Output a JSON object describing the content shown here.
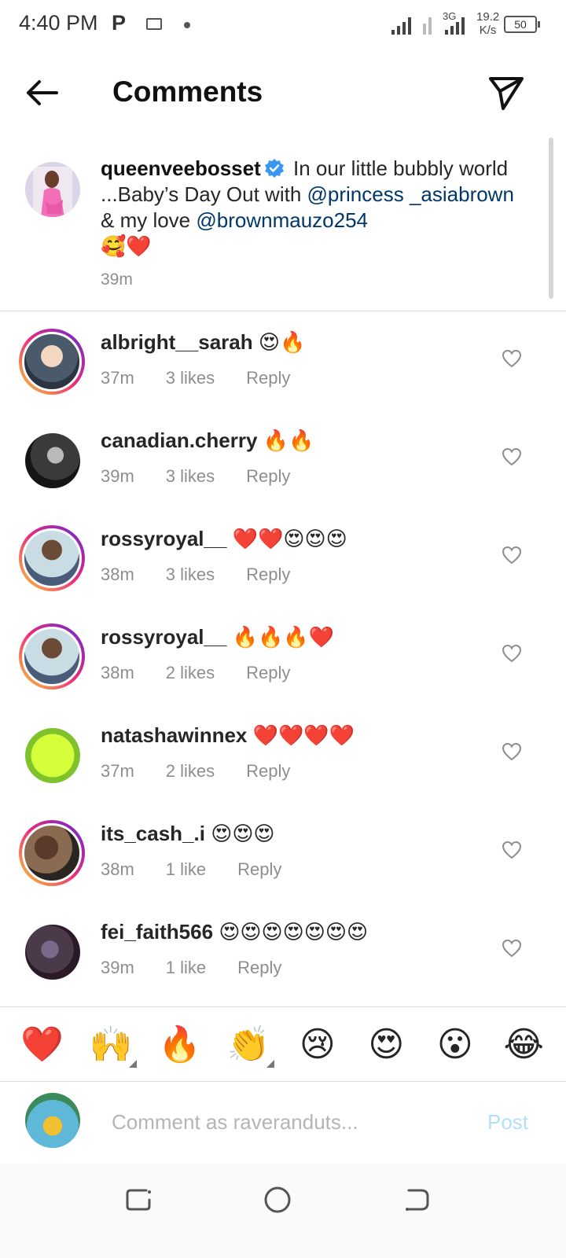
{
  "status_bar": {
    "time": "4:40 PM",
    "p_label": "P",
    "network_type": "3G",
    "speed_value": "19.2",
    "speed_unit": "K/s",
    "battery": "50"
  },
  "header": {
    "title": "Comments",
    "back_icon": "back-arrow-icon",
    "send_icon": "paper-plane-icon"
  },
  "caption": {
    "username": "queenveebosset",
    "verified": true,
    "text_1": " In our little bubbly world ...Baby’s Day Out with ",
    "mention_1": "@princess _asiabrown",
    "text_2": " & my love ",
    "mention_2": "@brownmauzo254",
    "emoji": "🥰❤️",
    "time": "39m"
  },
  "comments": [
    {
      "username": "albright__sarah",
      "text": "😍🔥",
      "time": "37m",
      "likes": "3 likes",
      "reply": "Reply",
      "story_ring": true
    },
    {
      "username": "canadian.cherry",
      "text": "🔥🔥",
      "time": "39m",
      "likes": "3 likes",
      "reply": "Reply",
      "story_ring": false
    },
    {
      "username": "rossyroyal__",
      "text": "❤️❤️😍😍😍",
      "time": "38m",
      "likes": "3 likes",
      "reply": "Reply",
      "story_ring": true
    },
    {
      "username": "rossyroyal__",
      "text": "🔥🔥🔥❤️",
      "time": "38m",
      "likes": "2 likes",
      "reply": "Reply",
      "story_ring": true
    },
    {
      "username": "natashawinnex",
      "text": "❤️❤️❤️❤️",
      "time": "37m",
      "likes": "2 likes",
      "reply": "Reply",
      "story_ring": false
    },
    {
      "username": "its_cash_.i",
      "text": "😍😍😍",
      "time": "38m",
      "likes": "1 like",
      "reply": "Reply",
      "story_ring": true
    },
    {
      "username": "fei_faith566",
      "text": "😍😍😍😍😍😍😍",
      "time": "39m",
      "likes": "1 like",
      "reply": "Reply",
      "story_ring": false
    }
  ],
  "emoji_bar": [
    "❤️",
    "🙌",
    "🔥",
    "👏",
    "😢",
    "😍",
    "😮",
    "😂"
  ],
  "composer": {
    "placeholder": "Comment as raveranduts...",
    "post_label": "Post"
  },
  "colors": {
    "link": "#00376b",
    "meta": "#8e8e8e",
    "post_disabled": "#b2dffc",
    "verified": "#3897f0"
  }
}
